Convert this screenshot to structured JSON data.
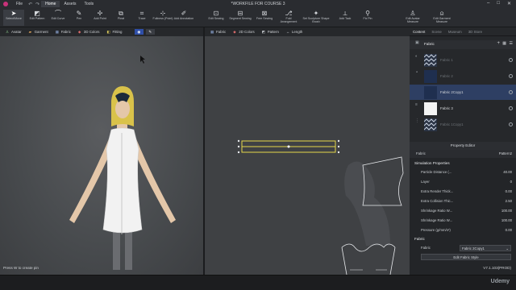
{
  "menubar": {
    "items": [
      "File",
      "Home",
      "Assets",
      "Tools"
    ],
    "active": "Home"
  },
  "window": {
    "title": "*WORKFILE FOR COURSE 3"
  },
  "toolbar": {
    "tools": [
      {
        "label": "Select/Move",
        "icon": "cursor-icon"
      },
      {
        "label": "Edit Pattern",
        "icon": "edit-pattern-icon"
      },
      {
        "label": "Edit Curve",
        "icon": "edit-curve-icon"
      },
      {
        "label": "Pen",
        "icon": "pen-icon"
      },
      {
        "label": "Add Point",
        "icon": "add-point-icon"
      },
      {
        "label": "Pleat",
        "icon": "pleat-icon"
      },
      {
        "label": "Trace",
        "icon": "trace-icon"
      },
      {
        "label": "Fullness (Point)",
        "icon": "fullness-icon"
      },
      {
        "label": "Add Annotation",
        "icon": "annotation-icon"
      },
      {
        "label": "Edit Sewing",
        "icon": "edit-sewing-icon"
      },
      {
        "label": "Segment Sewing",
        "icon": "segment-sewing-icon"
      },
      {
        "label": "Free Sewing",
        "icon": "free-sewing-icon"
      },
      {
        "label": "Fold Arrangement",
        "icon": "fold-icon"
      },
      {
        "label": "Set Sculpture Shape Brush",
        "icon": "brush-icon"
      },
      {
        "label": "Add Tack",
        "icon": "tack-icon"
      },
      {
        "label": "Fix Pin",
        "icon": "pin-icon"
      },
      {
        "label": "Edit Avatar Measure",
        "icon": "avatar-measure-icon"
      },
      {
        "label": "Edit Garment Measure",
        "icon": "garment-measure-icon"
      }
    ]
  },
  "viewport3d": {
    "buttons": [
      "Avatar",
      "Garment",
      "Fabric",
      "3D Colors",
      "Fitting"
    ]
  },
  "viewport2d": {
    "buttons": [
      "Fabric",
      "2D Colors",
      "Pattern",
      "Length"
    ]
  },
  "right_tabs": {
    "items": [
      "Content",
      "Scene",
      "Museum",
      "3D Store"
    ],
    "active": "Content"
  },
  "object_browser": {
    "header": "Fabric",
    "items": [
      {
        "name": "Fabric 1",
        "dim": true,
        "thumb": "stripes"
      },
      {
        "name": "Fabric 2",
        "dim": true,
        "thumb": "navy"
      },
      {
        "name": "Fabric 2Copy1",
        "dim": false,
        "thumb": "navy",
        "selected": true
      },
      {
        "name": "Fabric 3",
        "dim": false,
        "thumb": "white"
      },
      {
        "name": "Fabric 1Copy1",
        "dim": true,
        "thumb": "stripes"
      }
    ]
  },
  "property_editor": {
    "title": "Property Editor",
    "object_label": "Fabric",
    "object_name": "Pattern2",
    "section_sim": "Simulation Properties",
    "rows": [
      {
        "key": "Particle Distance (...",
        "value": "40.00"
      },
      {
        "key": "Layer",
        "value": "0"
      },
      {
        "key": "Extra Render Thick...",
        "value": "0.00"
      },
      {
        "key": "Extra Collision Thic...",
        "value": "2.50"
      },
      {
        "key": "Shrinkage Ratio W...",
        "value": "100.00"
      },
      {
        "key": "Shrinkage Ratio W...",
        "value": "100.00"
      },
      {
        "key": "Pressure (g/mm/s²)",
        "value": "0.00"
      }
    ],
    "section_fabric": "Fabric",
    "fabric_label": "Fabric",
    "fabric_value": "Fabric 2Copy1",
    "edit_button": "Edit Fabric Style"
  },
  "status": {
    "text": "Press W to create pin",
    "version": "V7.1.103(PROD)"
  },
  "watermark": "Udemy",
  "colors": {
    "accent_select": "#3a6fd8",
    "pattern_outline": "#e6d84a",
    "hair": "#d9c24a"
  }
}
